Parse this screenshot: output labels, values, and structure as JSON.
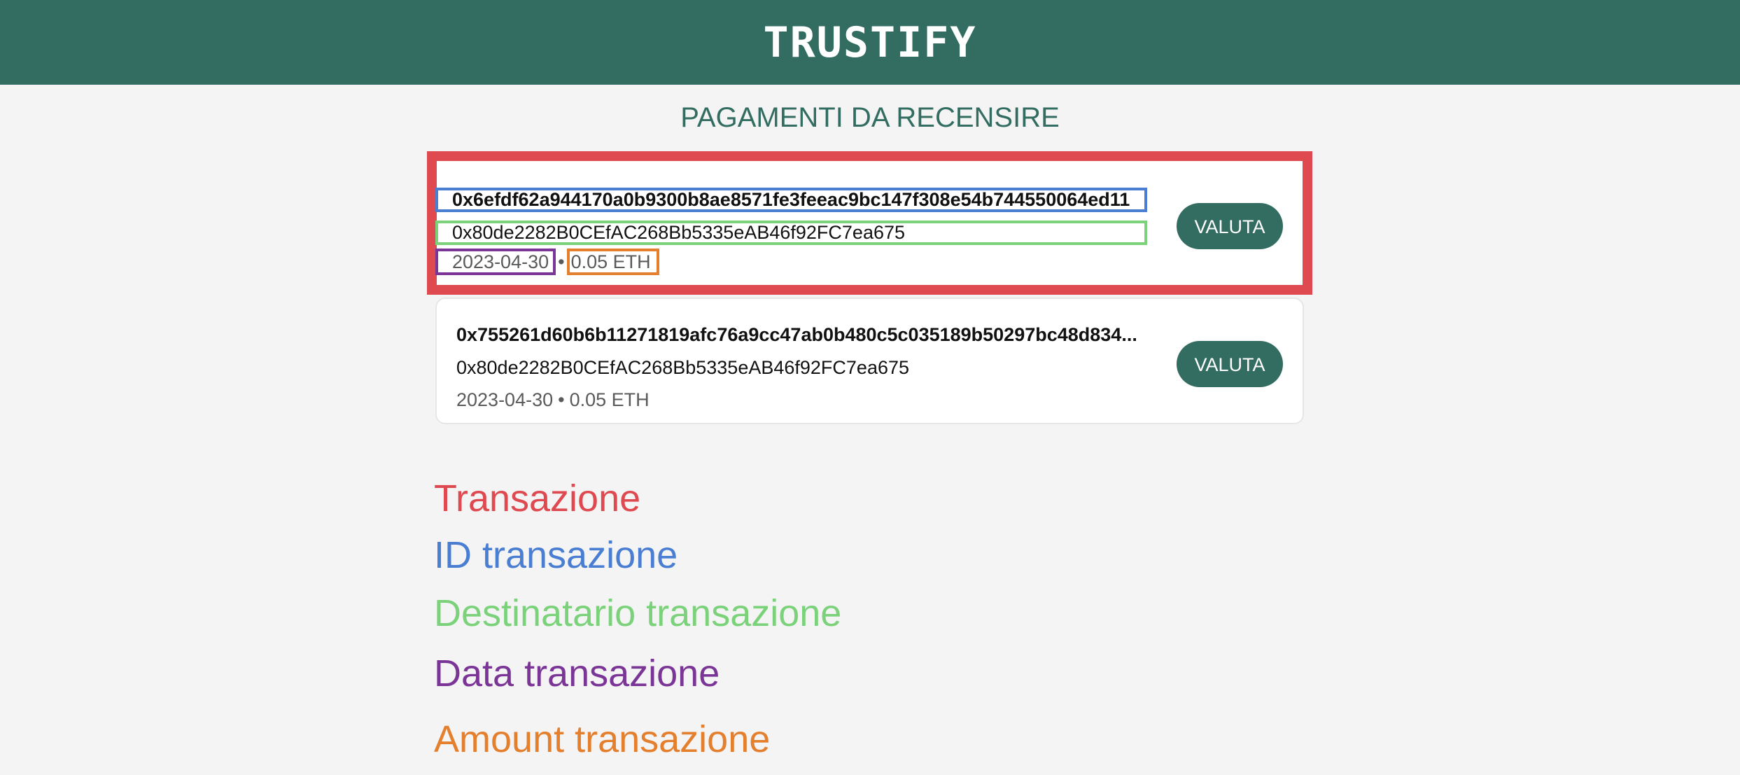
{
  "header": {
    "title": "TRUSTIFY",
    "bg_color": "#336d61"
  },
  "page": {
    "section_title": "PAGAMENTI DA RECENSIRE"
  },
  "transactions": [
    {
      "id": "0x6efdf62a944170a0b9300b8ae8571fe3feeac9bc147f308e54b744550064ed11",
      "recipient": "0x80de2282B0CEfAC268Bb5335eAB46f92FC7ea675",
      "date": "2023-04-30",
      "separator": "•",
      "amount": "0.05 ETH",
      "button_label": "VALUTA"
    },
    {
      "id": "0x755261d60b6b11271819afc76a9cc47ab0b480c5c035189b50297bc48d834...",
      "recipient": "0x80de2282B0CEfAC268Bb5335eAB46f92FC7ea675",
      "date": "2023-04-30",
      "separator": "•",
      "amount": "0.05 ETH",
      "button_label": "VALUTA"
    }
  ],
  "legend": {
    "transaction": {
      "label": "Transazione",
      "color": "#df4a51"
    },
    "id": {
      "label": "ID transazione",
      "color": "#4a7ed3"
    },
    "recipient": {
      "label": "Destinatario transazione",
      "color": "#7bd27b"
    },
    "date": {
      "label": "Data transazione",
      "color": "#7a3596"
    },
    "amount": {
      "label": "Amount transazione",
      "color": "#e47f2e"
    }
  }
}
